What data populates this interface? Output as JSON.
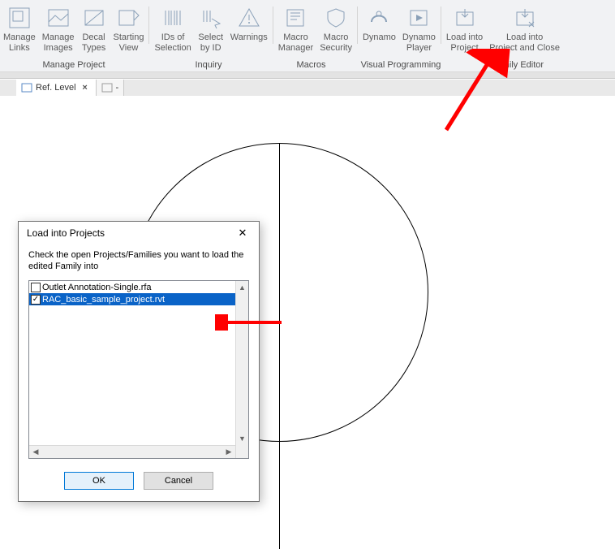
{
  "ribbon": {
    "buttons": {
      "manage_links": "Manage\nLinks",
      "manage_images": "Manage\nImages",
      "decal_types": "Decal\nTypes",
      "starting_view": "Starting\nView",
      "ids_selection": "IDs of\nSelection",
      "select_by_id": "Select\nby ID",
      "warnings": "Warnings",
      "macro_manager": "Macro\nManager",
      "macro_security": "Macro\nSecurity",
      "dynamo": "Dynamo",
      "dynamo_player": "Dynamo\nPlayer",
      "load_into_project": "Load into\nProject",
      "load_project_close": "Load into\nProject and Close"
    },
    "groups": {
      "manage_project": "Manage Project",
      "inquiry": "Inquiry",
      "macros": "Macros",
      "visual_programming": "Visual Programming",
      "family_editor": "Family Editor"
    }
  },
  "tabs": {
    "active": "Ref. Level",
    "inactive": "-"
  },
  "dialog": {
    "title": "Load into Projects",
    "message": "Check the open Projects/Families you want to load the edited Family into",
    "items": [
      {
        "label": "Outlet Annotation-Single.rfa",
        "checked": false,
        "selected": false
      },
      {
        "label": "RAC_basic_sample_project.rvt",
        "checked": true,
        "selected": true
      }
    ],
    "ok": "OK",
    "cancel": "Cancel",
    "close_glyph": "✕"
  }
}
